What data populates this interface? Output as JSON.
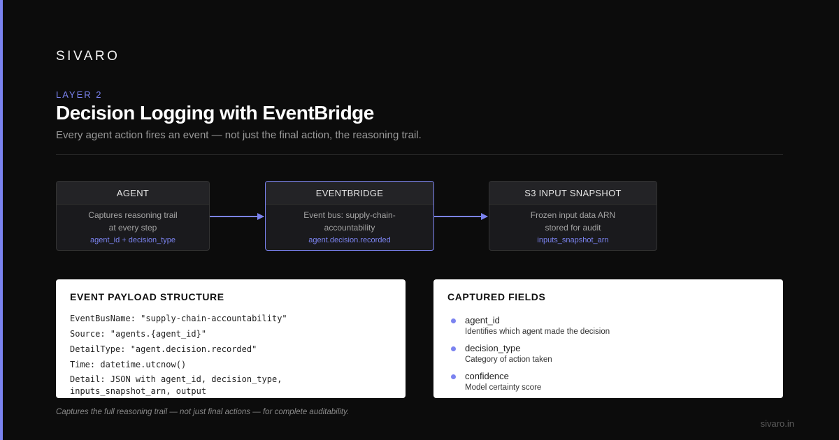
{
  "brand": "SIVARO",
  "layer_label": "LAYER 2",
  "title": "Decision Logging with EventBridge",
  "subtitle": "Every agent action fires an event — not just the final action, the reasoning trail.",
  "nodes": [
    {
      "title": "AGENT",
      "line1": "Captures reasoning trail",
      "line2": "at every step",
      "tag": "agent_id + decision_type"
    },
    {
      "title": "EVENTBRIDGE",
      "line1": "Event bus: supply-chain-",
      "line2": "accountability",
      "tag": "agent.decision.recorded"
    },
    {
      "title": "S3 INPUT SNAPSHOT",
      "line1": "Frozen input data ARN",
      "line2": "stored for audit",
      "tag": "inputs_snapshot_arn"
    }
  ],
  "payload": {
    "title": "EVENT PAYLOAD STRUCTURE",
    "lines": [
      "EventBusName: \"supply-chain-accountability\"",
      "Source: \"agents.{agent_id}\"",
      "DetailType: \"agent.decision.recorded\"",
      "Time: datetime.utcnow()",
      "Detail: JSON with agent_id, decision_type,",
      "inputs_snapshot_arn, output"
    ]
  },
  "fields": {
    "title": "CAPTURED FIELDS",
    "items": [
      {
        "name": "agent_id",
        "desc": "Identifies which agent made the decision"
      },
      {
        "name": "decision_type",
        "desc": "Category of action taken"
      },
      {
        "name": "confidence",
        "desc": "Model certainty score"
      }
    ]
  },
  "footnote": "Captures the full reasoning trail — not just final actions — for complete auditability.",
  "site": "sivaro.in",
  "colors": {
    "accent": "#7b83f0",
    "background": "#0c0c0c"
  }
}
